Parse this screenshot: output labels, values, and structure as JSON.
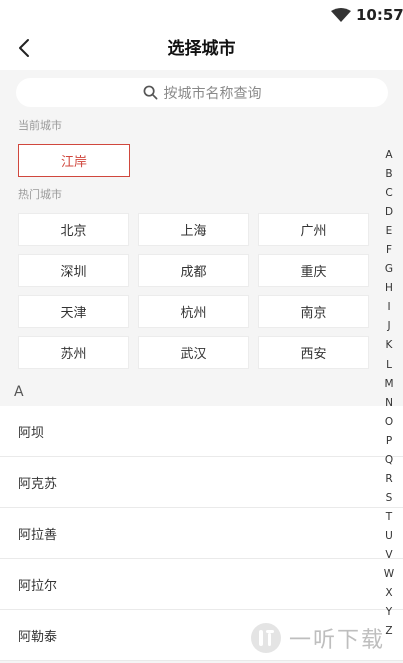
{
  "status_bar": {
    "time": "10:57",
    "wifi_icon": "wifi-icon"
  },
  "header": {
    "title": "选择城市",
    "back_icon": "chevron-left-icon"
  },
  "search": {
    "placeholder": "按城市名称查询",
    "icon": "search-icon"
  },
  "current": {
    "label": "当前城市",
    "city": "江岸",
    "accent_color": "#d0473d"
  },
  "hot": {
    "label": "热门城市",
    "cities": [
      "北京",
      "上海",
      "广州",
      "深圳",
      "成都",
      "重庆",
      "天津",
      "杭州",
      "南京",
      "苏州",
      "武汉",
      "西安"
    ]
  },
  "list": {
    "group_letter": "A",
    "items": [
      "阿坝",
      "阿克苏",
      "阿拉善",
      "阿拉尔",
      "阿勒泰"
    ]
  },
  "index_letters": [
    "A",
    "B",
    "C",
    "D",
    "E",
    "F",
    "G",
    "H",
    "I",
    "J",
    "K",
    "L",
    "M",
    "N",
    "O",
    "P",
    "Q",
    "R",
    "S",
    "T",
    "U",
    "V",
    "W",
    "X",
    "Y",
    "Z"
  ],
  "watermark": {
    "text": "一听下载"
  }
}
